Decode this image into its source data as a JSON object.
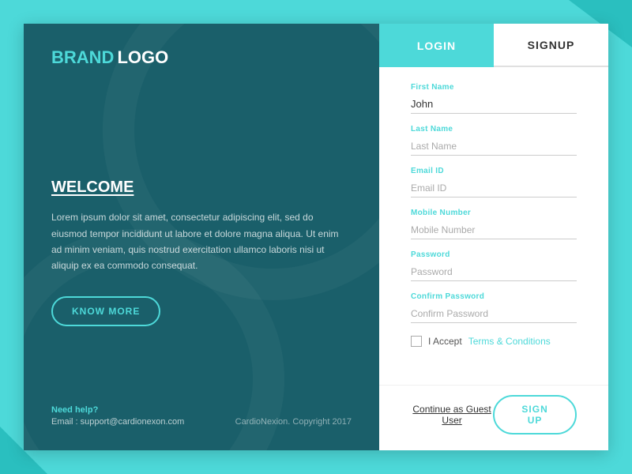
{
  "brand": {
    "brand_word": "BRAND",
    "logo_word": "LOGO"
  },
  "left_panel": {
    "welcome_title": "WELCOME",
    "welcome_text": "Lorem ipsum dolor sit amet, consectetur adipiscing elit, sed do eiusmod tempor incididunt ut labore et dolore magna aliqua. Ut enim ad minim veniam, quis nostrud exercitation ullamco laboris nisi ut aliquip ex ea commodo consequat.",
    "know_more_label": "KNOW MORE",
    "need_help_label": "Need help?",
    "email_label": "Email : support@cardionexon.com",
    "copyright_label": "CardioNexion. Copyright 2017"
  },
  "tabs": {
    "login_label": "LOGIN",
    "signup_label": "SIGNUP"
  },
  "form": {
    "first_name_label": "First Name",
    "first_name_value": "John",
    "last_name_label": "Last Name",
    "last_name_placeholder": "Last Name",
    "email_label": "Email ID",
    "email_placeholder": "Email ID",
    "mobile_label": "Mobile Number",
    "mobile_placeholder": "Mobile Number",
    "password_label": "Password",
    "password_placeholder": "Password",
    "confirm_password_label": "Confirm Password",
    "confirm_password_placeholder": "Confirm Password",
    "terms_text": "I Accept",
    "terms_link": "Terms & Conditions",
    "guest_label": "Continue as Guest User",
    "signup_button": "SIGN UP"
  }
}
